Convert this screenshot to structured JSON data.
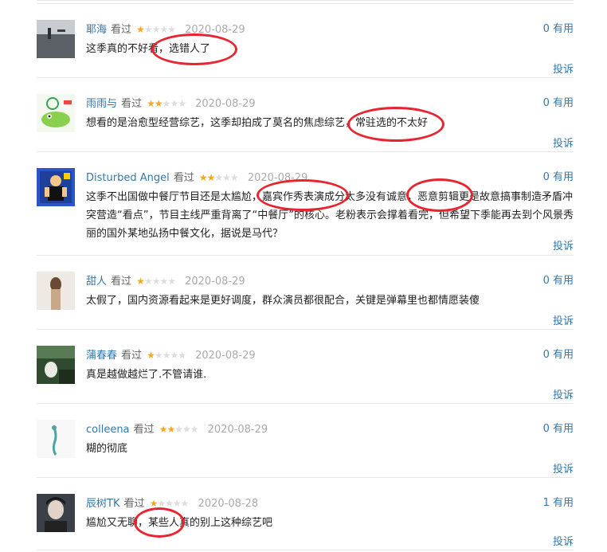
{
  "reviews": [
    {
      "user": "耶海",
      "watched": "看过",
      "stars": 1,
      "date": "2020-08-29",
      "useful_count": "0",
      "useful_label": "有用",
      "content": "这季真的不好看，选错人了",
      "report": "投诉",
      "avatar_icon": "lake-photo-avatar"
    },
    {
      "user": "雨雨与",
      "watched": "看过",
      "stars": 2,
      "date": "2020-08-29",
      "useful_count": "0",
      "useful_label": "有用",
      "content": "想看的是治愈型经营综艺，这季却拍成了莫名的焦虑综艺，常驻选的不太好",
      "report": "投诉",
      "avatar_icon": "cartoon-frog-avatar"
    },
    {
      "user": "Disturbed Angel",
      "watched": "看过",
      "stars": 2,
      "date": "2020-08-29",
      "useful_count": "0",
      "useful_label": "有用",
      "content": "这季不出国做中餐厅节目还是太尴尬，嘉宾作秀表演成分太多没有诚意，恶意剪辑更是故意搞事制造矛盾冲突营造“看点”，节目主线严重背离了“中餐厅”的核心。老粉表示会撑着看完，但希望下季能再去到个风景秀丽的国外某地弘扬中餐文化，据说是马代？",
      "report": "投诉",
      "avatar_icon": "cartoon-figure-avatar"
    },
    {
      "user": "甜人",
      "watched": "看过",
      "stars": 1,
      "date": "2020-08-29",
      "useful_count": "0",
      "useful_label": "有用",
      "content": "太假了，国内资源看起来是更好调度，群众演员都很配合，关键是弹幕里也都情愿装傻",
      "report": "投诉",
      "avatar_icon": "portrait-avatar"
    },
    {
      "user": "蒲春春",
      "watched": "看过",
      "stars": 1,
      "date": "2020-08-29",
      "useful_count": "0",
      "useful_label": "有用",
      "content": "真是越做越烂了.不管请谁.",
      "report": "投诉",
      "avatar_icon": "landscape-avatar"
    },
    {
      "user": "colleena",
      "watched": "看过",
      "stars": 2,
      "date": "2020-08-29",
      "useful_count": "0",
      "useful_label": "有用",
      "content": "糊的彻底",
      "report": "投诉",
      "avatar_icon": "sketch-avatar"
    },
    {
      "user": "辰树TK",
      "watched": "看过",
      "stars": 1,
      "date": "2020-08-28",
      "useful_count": "1",
      "useful_label": "有用",
      "content": "尴尬又无聊，某些人真的别上这种综艺吧",
      "report": "投诉",
      "avatar_icon": "person-photo-avatar"
    }
  ],
  "colors": {
    "link": "#3377aa",
    "star_on": "#f5a623",
    "annotation": "#e8242f"
  }
}
